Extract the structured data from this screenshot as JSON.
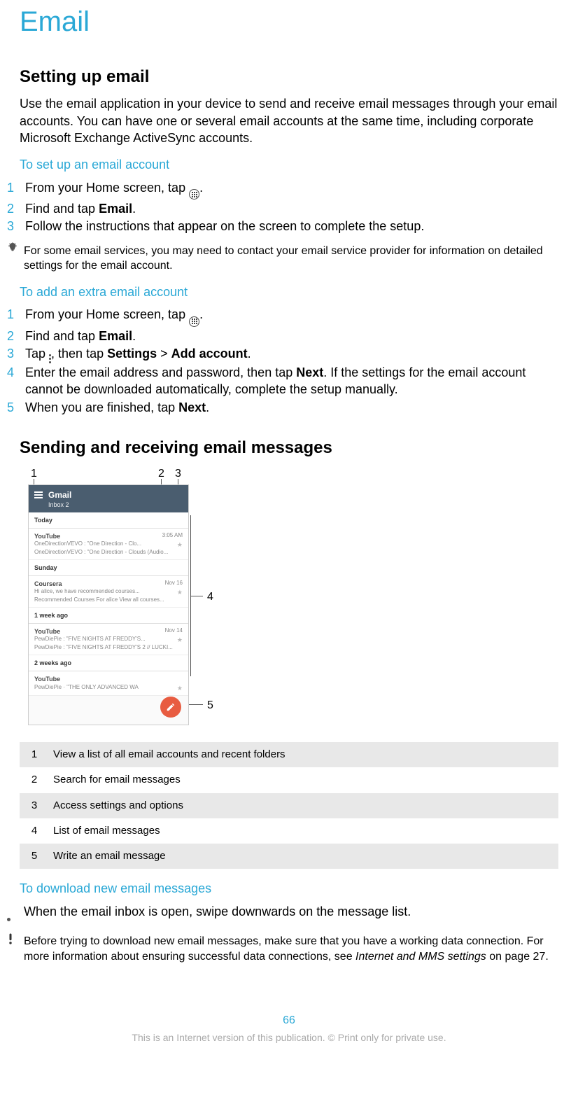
{
  "title": "Email",
  "section1": {
    "heading": "Setting up email",
    "intro": "Use the email application in your device to send and receive email messages through your email accounts. You can have one or several email accounts at the same time, including corporate Microsoft Exchange ActiveSync accounts.",
    "sub1": "To set up an email account",
    "steps1": [
      {
        "n": "1",
        "a": "From your Home screen, tap ",
        "b": "."
      },
      {
        "n": "2",
        "a": "Find and tap ",
        "bold": "Email",
        "b": "."
      },
      {
        "n": "3",
        "a": "Follow the instructions that appear on the screen to complete the setup."
      }
    ],
    "tip1": "For some email services, you may need to contact your email service provider for information on detailed settings for the email account.",
    "sub2": "To add an extra email account",
    "steps2": {
      "s1": {
        "n": "1",
        "a": "From your Home screen, tap ",
        "b": "."
      },
      "s2": {
        "n": "2",
        "a": "Find and tap ",
        "bold": "Email",
        "b": "."
      },
      "s3": {
        "n": "3",
        "a": "Tap ",
        "mid": ", then tap ",
        "bold1": "Settings",
        "gt": " > ",
        "bold2": "Add account",
        "b": "."
      },
      "s4": {
        "n": "4",
        "a": "Enter the email address and password, then tap ",
        "bold": "Next",
        "b": ". If the settings for the email account cannot be downloaded automatically, complete the setup manually."
      },
      "s5": {
        "n": "5",
        "a": "When you are finished, tap ",
        "bold": "Next",
        "b": "."
      }
    }
  },
  "section2": {
    "heading": "Sending and receiving email messages",
    "callouts": {
      "c1": "1",
      "c2": "2",
      "c3": "3",
      "c4": "4",
      "c5": "5"
    },
    "mock": {
      "title": "Gmail",
      "subtitle": "Inbox 2",
      "groups": [
        {
          "h": "Today",
          "msgs": [
            {
              "t": "YouTube",
              "time": "3:05 AM",
              "l1": "OneDirectionVEVO : \"One Direction - Clo...",
              "l2": "OneDirectionVEVO : \"One Direction - Clouds (Audio..."
            }
          ]
        },
        {
          "h": "Sunday",
          "msgs": [
            {
              "t": "Coursera",
              "time": "Nov 16",
              "l1": "Hi alice, we have recommended courses...",
              "l2": "Recommended Courses For alice View all courses..."
            }
          ]
        },
        {
          "h": "1 week ago",
          "msgs": [
            {
              "t": "YouTube",
              "time": "Nov 14",
              "l1": "PewDiePie : \"FIVE NIGHTS AT FREDDY'S...",
              "l2": "PewDiePie : \"FIVE NIGHTS AT FREDDY'S 2 // LUCKI..."
            }
          ]
        },
        {
          "h": "2 weeks ago",
          "msgs": [
            {
              "t": "YouTube",
              "time": "",
              "l1": "PewDiePie · \"THE ONLY ADVANCED WA",
              "l2": ""
            }
          ]
        }
      ]
    },
    "legend": [
      {
        "k": "1",
        "v": "View a list of all email accounts and recent folders"
      },
      {
        "k": "2",
        "v": "Search for email messages"
      },
      {
        "k": "3",
        "v": "Access settings and options"
      },
      {
        "k": "4",
        "v": "List of email messages"
      },
      {
        "k": "5",
        "v": "Write an email message"
      }
    ],
    "sub3": "To download new email messages",
    "bullet1": "When the email inbox is open, swipe downwards on the message list.",
    "warn": {
      "a": "Before trying to download new email messages, make sure that you have a working data connection. For more information about ensuring successful data connections, see ",
      "i": "Internet and MMS settings",
      "b": " on page 27."
    }
  },
  "pagenum": "66",
  "copyright": "This is an Internet version of this publication. © Print only for private use."
}
